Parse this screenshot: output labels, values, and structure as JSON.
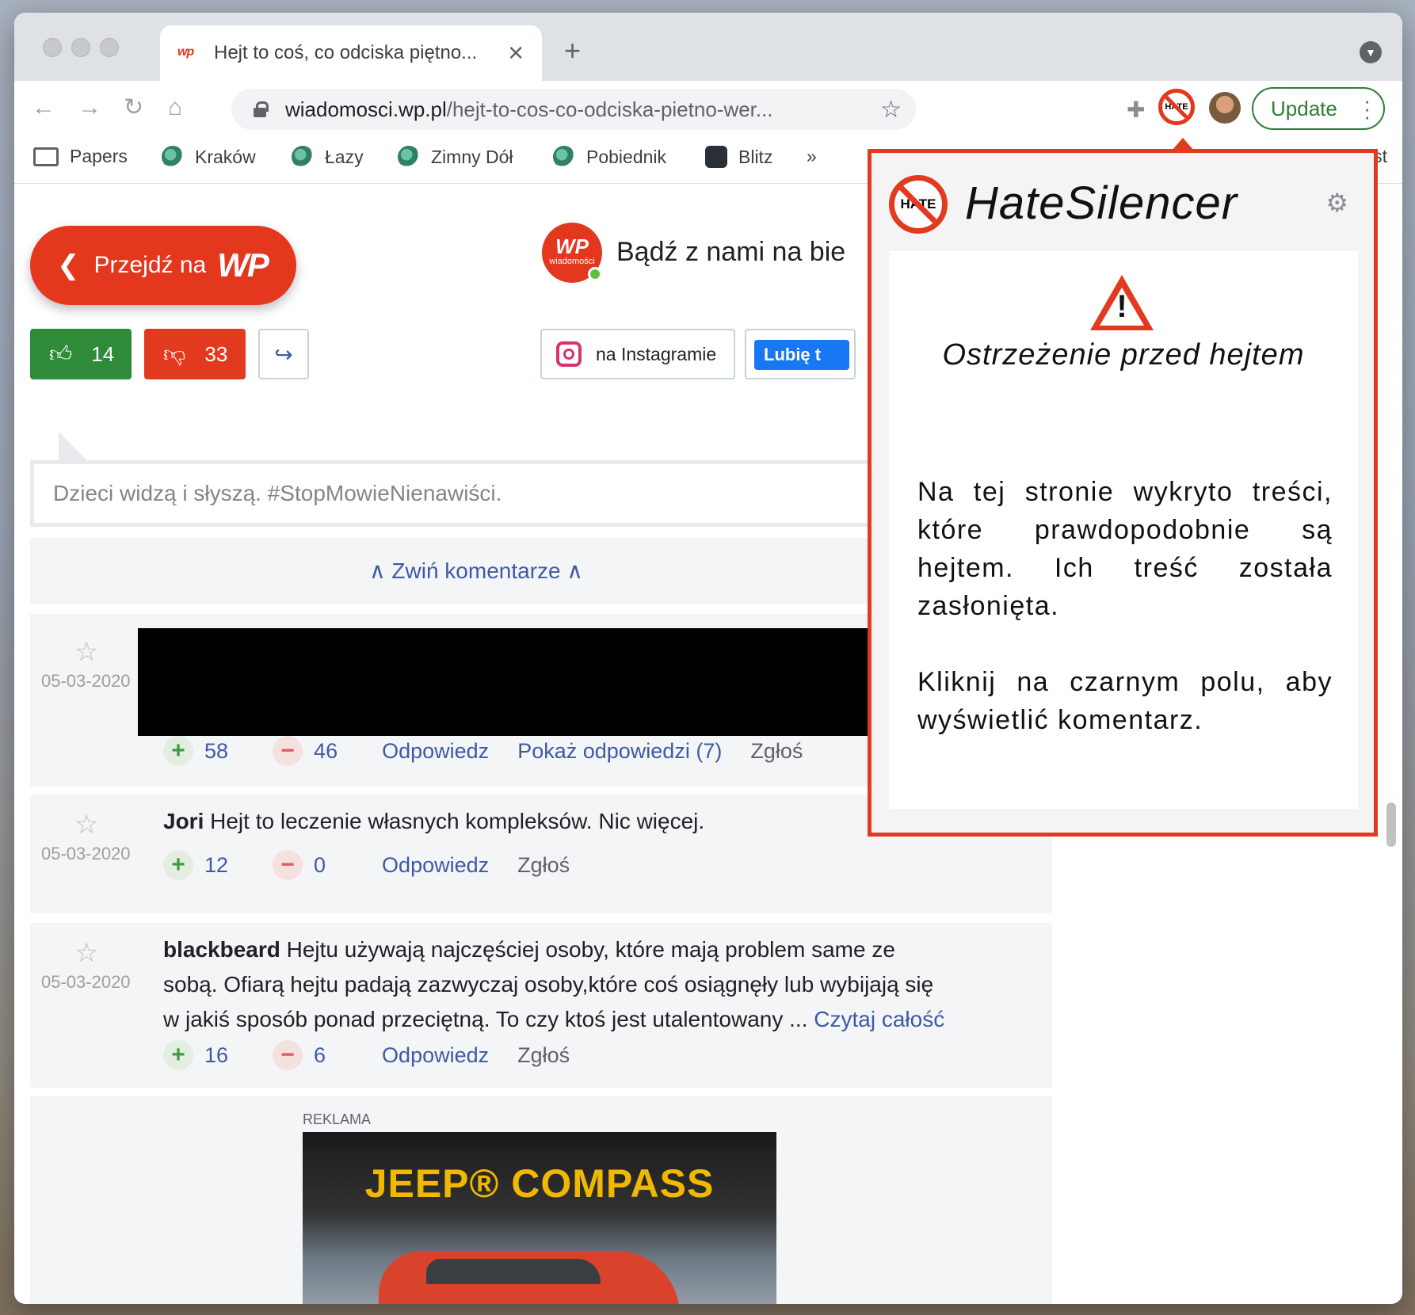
{
  "browser": {
    "tab_title": "Hejt to coś, co odciska piętno...",
    "tab_favicon": "wp",
    "new_tab": "+",
    "url_domain": "wiadomosci.wp.pl",
    "url_path": "/hejt-to-cos-co-odciska-pietno-wer...",
    "update_label": "Update",
    "ext_badge": "HATE",
    "bookmarks": [
      "Papers",
      "Kraków",
      "Łazy",
      "Zimny Dół",
      "Pobiednik",
      "Blitz"
    ],
    "bookmarks_more": "»",
    "bookmark_cut": "ist"
  },
  "page": {
    "przejdz_label": "Przejdź na",
    "przejdz_logo": "WP",
    "likes": "14",
    "dislikes": "33",
    "wp_avatar_logo": "WP",
    "wp_avatar_sub": "wiadomości",
    "badz_text": "Bądź z nami na bie",
    "instagram_label": "na Instagramie",
    "fb_label": "Lubię t",
    "comment_placeholder": "Dzieci widzą i słyszą. #StopMowieNienawiści.",
    "collapse_label": "∧ Zwiń komentarze ∧",
    "comments": [
      {
        "date": "05-03-2020",
        "author": "",
        "text": "",
        "plus": "58",
        "minus": "46",
        "reply": "Odpowiedz",
        "show_replies": "Pokaż odpowiedzi (7)",
        "report": "Zgłoś"
      },
      {
        "date": "05-03-2020",
        "author": "Jori",
        "text": " Hejt to leczenie własnych kompleksów. Nic więcej.",
        "plus": "12",
        "minus": "0",
        "reply": "Odpowiedz",
        "report": "Zgłoś"
      },
      {
        "date": "05-03-2020",
        "author": "blackbeard",
        "text": " Hejtu używają najczęściej osoby, które mają problem same ze sobą. Ofiarą hejtu padają zazwyczaj osoby,które coś osiągnęły lub wybijają się w jakiś sposób ponad przeciętną. To czy ktoś jest utalentowany ... ",
        "more": "Czytaj całość",
        "plus": "16",
        "minus": "6",
        "reply": "Odpowiedz",
        "report": "Zgłoś"
      }
    ],
    "ad_label": "REKLAMA",
    "ad_title": "JEEP® COMPASS"
  },
  "popup": {
    "logo_text": "HATE",
    "title": "HateSilencer",
    "warning_title": "Ostrzeżenie przed hejtem",
    "warning_excl": "!",
    "paragraph1": "Na tej stronie wykryto treści, które prawdopodobnie są hejtem. Ich treść została zasłonięta.",
    "paragraph2": "Kliknij na czarnym polu, aby wyświetlić komentarz."
  },
  "colors": {
    "accent_red": "#e23a1f",
    "like_green": "#2e8b3a",
    "link_blue": "#3d5aa8"
  },
  "icons": [
    "back-icon",
    "forward-icon",
    "reload-icon",
    "home-icon",
    "lock-icon",
    "star-icon",
    "puzzle-icon",
    "gear-icon",
    "warning-icon",
    "thumbs-up-icon",
    "thumbs-down-icon",
    "share-icon"
  ]
}
